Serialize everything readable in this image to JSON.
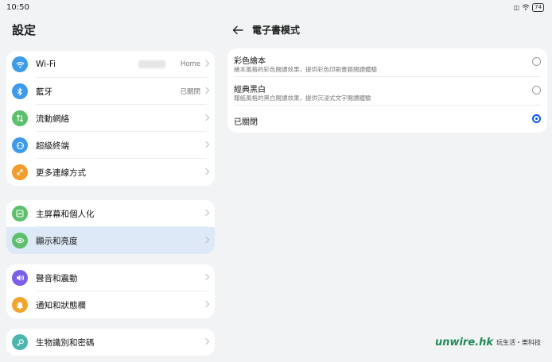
{
  "status_bar": {
    "time": "10:50",
    "battery": "74"
  },
  "left_panel": {
    "title": "設定",
    "groups": [
      {
        "items": [
          {
            "label": "Wi-Fi",
            "value": "Home",
            "icon": "wifi-icon",
            "color": "#3d9be9"
          },
          {
            "label": "藍牙",
            "value": "已關閉",
            "icon": "bluetooth-icon",
            "color": "#3d9be9"
          },
          {
            "label": "流動網絡",
            "value": "",
            "icon": "mobile-data-icon",
            "color": "#5cbf6c"
          },
          {
            "label": "超級終端",
            "value": "",
            "icon": "super-device-icon",
            "color": "#3d9be9"
          },
          {
            "label": "更多連線方式",
            "value": "",
            "icon": "connection-icon",
            "color": "#f39b2b"
          }
        ]
      },
      {
        "items": [
          {
            "label": "主屏幕和個人化",
            "value": "",
            "icon": "home-screen-icon",
            "color": "#5cbf6c"
          },
          {
            "label": "顯示和亮度",
            "value": "",
            "icon": "eye-icon",
            "color": "#5cbf6c"
          }
        ]
      },
      {
        "items": [
          {
            "label": "聲音和震動",
            "value": "",
            "icon": "sound-icon",
            "color": "#7b5fe8"
          },
          {
            "label": "通知和狀態欄",
            "value": "",
            "icon": "bell-icon",
            "color": "#f2a52e"
          }
        ]
      },
      {
        "items": [
          {
            "label": "生物識別和密碼",
            "value": "",
            "icon": "key-icon",
            "color": "#4db6ac"
          }
        ]
      }
    ]
  },
  "right_panel": {
    "title": "電子書模式",
    "options": [
      {
        "title": "彩色繪本",
        "subtitle": "繪本風格的彩色閱讀效果，提供彩色印刷書籍閱讀體驗",
        "selected": false
      },
      {
        "title": "經典黑白",
        "subtitle": "報紙風格的黑白閱讀效果，提供沉浸式文字閱讀體驗",
        "selected": false
      },
      {
        "title": "已關閉",
        "subtitle": "",
        "selected": true
      }
    ]
  },
  "watermark": {
    "logo": "unwire.hk",
    "tagline": "玩生活・樂科技"
  },
  "colors": {
    "accent": "#0a59f7",
    "active_row": "#dde9f6",
    "background": "#f1f3f5"
  }
}
